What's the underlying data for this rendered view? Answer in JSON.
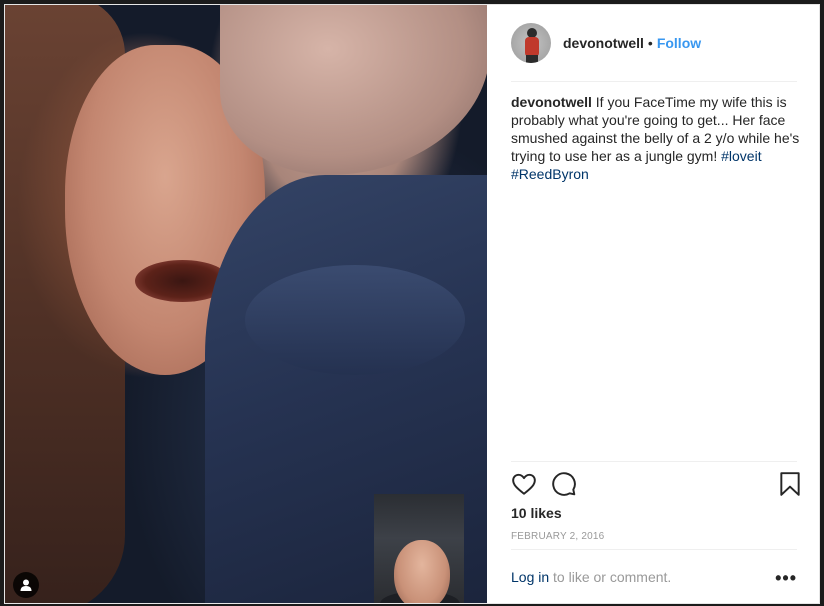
{
  "post": {
    "username": "devonotwell",
    "separator": "•",
    "follow_label": "Follow",
    "caption": {
      "user": "devonotwell",
      "text": " If you FaceTime my wife this is probably what you're going to get... Her face smushed against the belly of a 2 y/o while he's trying to use her as a jungle gym! ",
      "hashtag1": "#loveit",
      "hashtag2": "#ReedByron"
    },
    "likes": "10 likes",
    "date": "FEBRUARY 2, 2016",
    "login": {
      "link_label": "Log in",
      "suffix": " to like or comment."
    },
    "more_label": "•••"
  },
  "icons": {
    "like": "heart-icon",
    "comment": "comment-icon",
    "save": "bookmark-icon",
    "user_tags": "person-icon",
    "more": "more-options-icon"
  },
  "colors": {
    "link_blue": "#3897f0",
    "hashtag_navy": "#003569",
    "text": "#262626",
    "muted": "#999999"
  }
}
